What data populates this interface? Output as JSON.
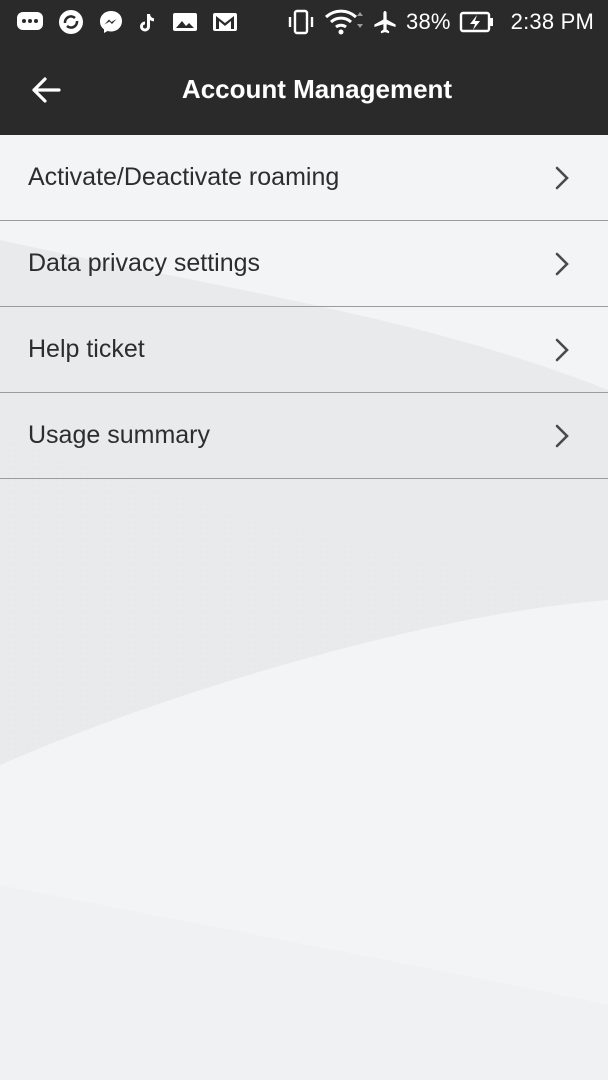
{
  "status_bar": {
    "time": "2:38 PM",
    "battery_percent": "38%",
    "left_icons": [
      "messaging-icon",
      "sync-app-icon",
      "messenger-icon",
      "tiktok-icon",
      "gallery-icon",
      "gmail-icon"
    ],
    "right_icons": [
      "vibrate-icon",
      "wifi-icon",
      "airplane-icon",
      "battery-charging-icon"
    ]
  },
  "app_bar": {
    "title": "Account Management",
    "back_icon": "arrow-left-icon"
  },
  "menu": {
    "items": [
      {
        "label": "Activate/Deactivate roaming",
        "icon": "chevron-right-icon"
      },
      {
        "label": "Data privacy settings",
        "icon": "chevron-right-icon"
      },
      {
        "label": "Help ticket",
        "icon": "chevron-right-icon"
      },
      {
        "label": "Usage summary",
        "icon": "chevron-right-icon"
      }
    ]
  },
  "colors": {
    "header_bg": "#2a2a2a",
    "page_bg": "#f3f4f6",
    "text": "#2d2d2d",
    "divider": "#9c9c9c"
  }
}
